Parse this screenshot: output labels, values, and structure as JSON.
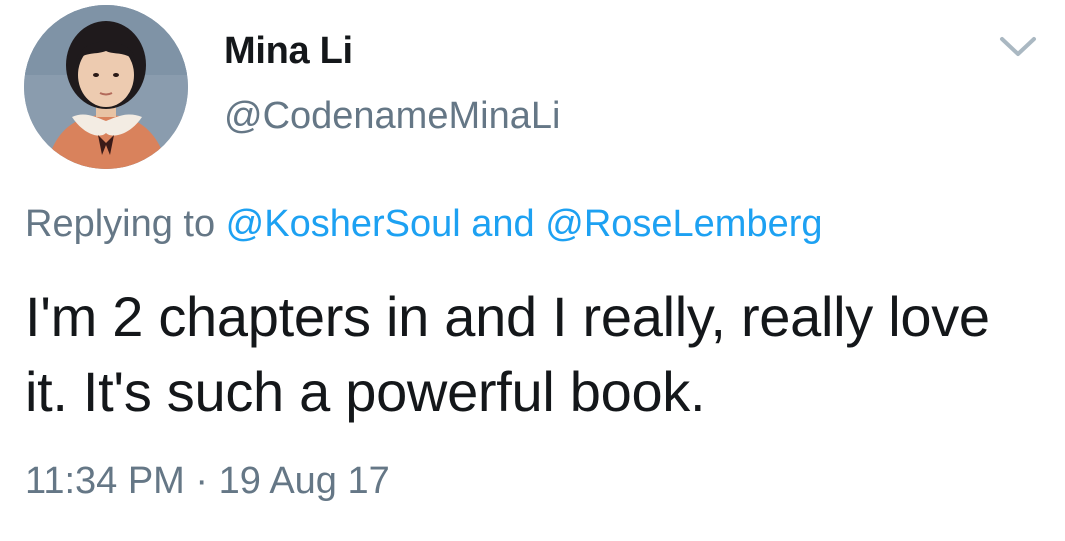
{
  "user": {
    "display_name": "Mina Li",
    "handle": "@CodenameMinaLi",
    "avatar_icon": "profile-photo"
  },
  "menu": {
    "caret_icon": "chevron-down-icon"
  },
  "reply": {
    "prefix": "Replying to ",
    "mention_1": "@KosherSoul",
    "joiner": " and ",
    "mention_2": "@RoseLemberg"
  },
  "tweet": {
    "text": "I'm 2 chapters in and I really, really love it. It's such a powerful book.",
    "timestamp": "11:34 PM · 19 Aug 17"
  },
  "colors": {
    "text": "#14171a",
    "secondary": "#657786",
    "link": "#1da1f2"
  }
}
